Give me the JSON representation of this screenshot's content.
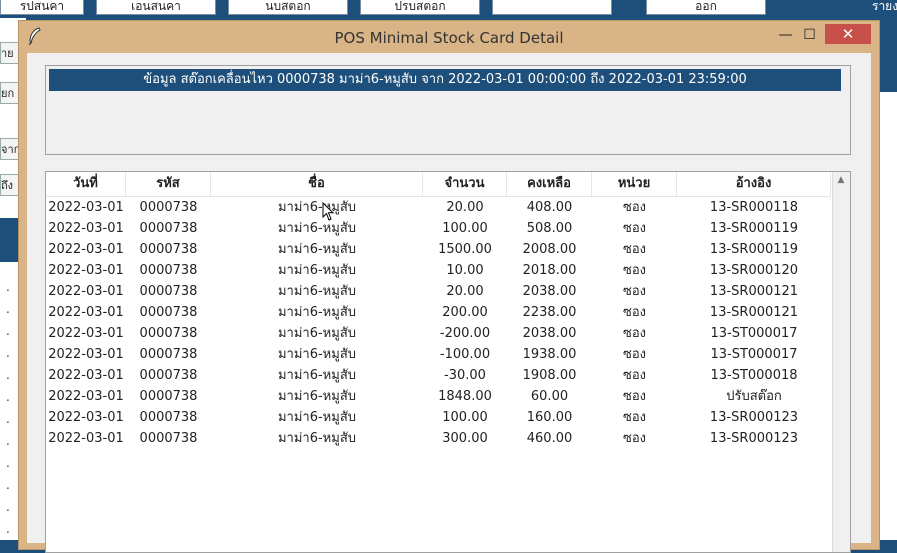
{
  "background": {
    "toolbar_buttons": [
      {
        "label": "รปสนคา"
      },
      {
        "label": "เอนสนคา"
      },
      {
        "label": "นบสตอก"
      },
      {
        "label": "ปรบสตอก"
      },
      {
        "label": ""
      },
      {
        "label": "ออก"
      }
    ],
    "left_labels": [
      "าย",
      "ยก",
      "จาก",
      "ถึง"
    ],
    "right_label": "รายง"
  },
  "window": {
    "title": "POS Minimal Stock Card Detail",
    "controls": {
      "minimize": "—",
      "maximize": "☐",
      "close": "✕"
    }
  },
  "info": {
    "banner": "ข้อมูล สต๊อกเคลื่อนไหว 0000738 มาม่า6-หมูสับ จาก 2022-03-01 00:00:00 ถึง 2022-03-01 23:59:00"
  },
  "table": {
    "columns": [
      "วันที่",
      "รหัส",
      "ชื่อ",
      "จำนวน",
      "คงเหลือ",
      "หน่วย",
      "อ้างอิง"
    ],
    "rows": [
      [
        "2022-03-01",
        "0000738",
        "มาม่า6-หมูสับ",
        "20.00",
        "408.00",
        "ซอง",
        "13-SR000118"
      ],
      [
        "2022-03-01",
        "0000738",
        "มาม่า6-หมูสับ",
        "100.00",
        "508.00",
        "ซอง",
        "13-SR000119"
      ],
      [
        "2022-03-01",
        "0000738",
        "มาม่า6-หมูสับ",
        "1500.00",
        "2008.00",
        "ซอง",
        "13-SR000119"
      ],
      [
        "2022-03-01",
        "0000738",
        "มาม่า6-หมูสับ",
        "10.00",
        "2018.00",
        "ซอง",
        "13-SR000120"
      ],
      [
        "2022-03-01",
        "0000738",
        "มาม่า6-หมูสับ",
        "20.00",
        "2038.00",
        "ซอง",
        "13-SR000121"
      ],
      [
        "2022-03-01",
        "0000738",
        "มาม่า6-หมูสับ",
        "200.00",
        "2238.00",
        "ซอง",
        "13-SR000121"
      ],
      [
        "2022-03-01",
        "0000738",
        "มาม่า6-หมูสับ",
        "-200.00",
        "2038.00",
        "ซอง",
        "13-ST000017"
      ],
      [
        "2022-03-01",
        "0000738",
        "มาม่า6-หมูสับ",
        "-100.00",
        "1938.00",
        "ซอง",
        "13-ST000017"
      ],
      [
        "2022-03-01",
        "0000738",
        "มาม่า6-หมูสับ",
        "-30.00",
        "1908.00",
        "ซอง",
        "13-ST000018"
      ],
      [
        "2022-03-01",
        "0000738",
        "มาม่า6-หมูสับ",
        "1848.00",
        "60.00",
        "ซอง",
        "ปรับสต๊อก"
      ],
      [
        "2022-03-01",
        "0000738",
        "มาม่า6-หมูสับ",
        "100.00",
        "160.00",
        "ซอง",
        "13-SR000123"
      ],
      [
        "2022-03-01",
        "0000738",
        "มาม่า6-หมูสับ",
        "300.00",
        "460.00",
        "ซอง",
        "13-SR000123"
      ]
    ]
  },
  "colors": {
    "window_frame": "#d8b487",
    "banner_bg": "#1e4f7a",
    "close_button": "#c7504a"
  }
}
